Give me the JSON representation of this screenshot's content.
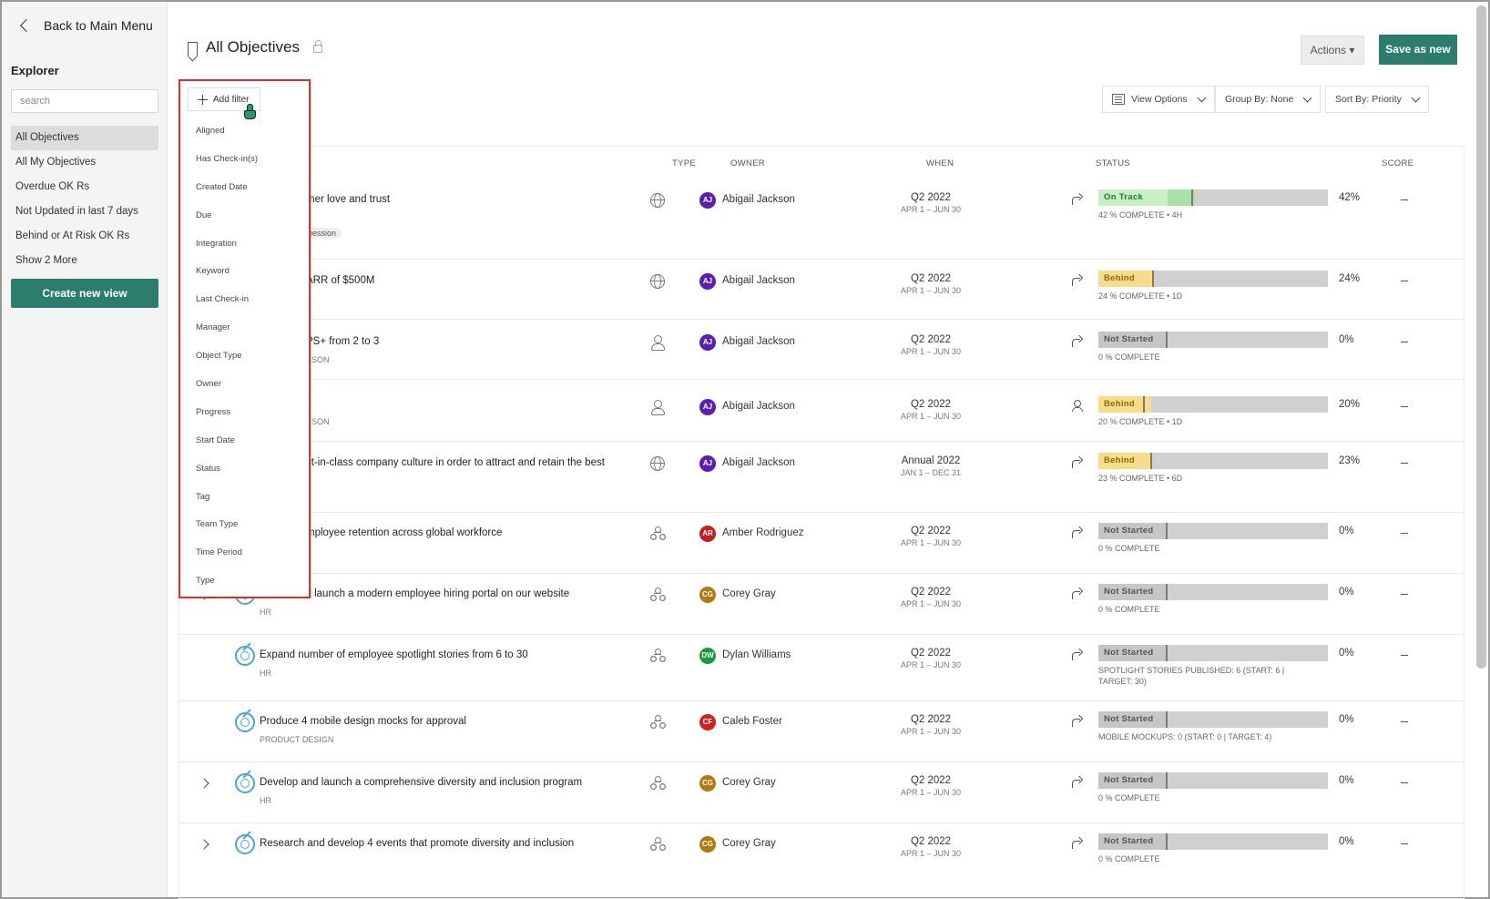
{
  "sidebar": {
    "back_label": "Back to Main Menu",
    "section_title": "Explorer",
    "search_placeholder": "search",
    "nav_items": [
      {
        "label": "All Objectives",
        "active": true
      },
      {
        "label": "All My Objectives",
        "active": false
      },
      {
        "label": "Overdue OK Rs",
        "active": false
      },
      {
        "label": "Not Updated in last 7 days",
        "active": false
      },
      {
        "label": "Behind or At Risk OK Rs",
        "active": false
      },
      {
        "label": "Show 2 More",
        "active": false
      }
    ],
    "create_button": "Create new view"
  },
  "header": {
    "title": "All Objectives",
    "actions_label": "Actions",
    "save_label": "Save as new"
  },
  "toolbar": {
    "view_options": "View Options",
    "group_by": "Group By: None",
    "sort_by": "Sort By: Priority"
  },
  "filter": {
    "add_label": "Add filter",
    "options": [
      "Aligned",
      "Has Check-in(s)",
      "Created Date",
      "Due",
      "Integration",
      "Keyword",
      "Last Check-in",
      "Manager",
      "Object Type",
      "Owner",
      "Progress",
      "Start Date",
      "Status",
      "Tag",
      "Team Type",
      "Time Period",
      "Type"
    ]
  },
  "columns": {
    "type": "TYPE",
    "owner": "OWNER",
    "when": "WHEN",
    "status": "STATUS",
    "score": "SCORE"
  },
  "colors": {
    "accent": "#2d7d6f",
    "on_track": "#a8e2a6",
    "behind": "#f7dc8c",
    "track_bg": "#d0d0d0",
    "highlight": "#e32b2b"
  },
  "rows": [
    {
      "title": "mer love and trust",
      "subtitle": "bession",
      "type_icon": "globe-icon",
      "owner": "Abigail Jackson",
      "initials": "AJ",
      "avatar_color": "#5a1fb0",
      "when": "Q2 2022",
      "when_range": "APR 1 – JUN 30",
      "action_icon": "share-icon",
      "status": "On Track",
      "progress": 42,
      "percent": "42%",
      "status_sub": "42 % COMPLETE • 4H",
      "status_sub2": "",
      "expandable": false
    },
    {
      "title": "ARR of $500M",
      "subtitle": "",
      "type_icon": "globe-icon",
      "owner": "Abigail Jackson",
      "initials": "AJ",
      "avatar_color": "#5a1fb0",
      "when": "Q2 2022",
      "when_range": "APR 1 – JUN 30",
      "action_icon": "share-icon",
      "status": "Behind",
      "progress": 24,
      "percent": "24%",
      "status_sub": "24 % COMPLETE • 1D",
      "status_sub2": "",
      "expandable": false
    },
    {
      "title": "PS+ from 2 to 3",
      "subtitle": "KSON",
      "type_icon": "person-icon",
      "owner": "Abigail Jackson",
      "initials": "AJ",
      "avatar_color": "#5a1fb0",
      "when": "Q2 2022",
      "when_range": "APR 1 – JUN 30",
      "action_icon": "share-icon",
      "status": "Not Started",
      "progress": 0,
      "percent": "0%",
      "status_sub": "0 % COMPLETE",
      "status_sub2": "",
      "expandable": false
    },
    {
      "title": "",
      "subtitle": "KSON",
      "type_icon": "person-icon",
      "owner": "Abigail Jackson",
      "initials": "AJ",
      "avatar_color": "#5a1fb0",
      "when": "Q2 2022",
      "when_range": "APR 1 – JUN 30",
      "action_icon": "user-icon",
      "status": "Behind",
      "progress": 20,
      "percent": "20%",
      "status_sub": "20 % COMPLETE • 1D",
      "status_sub2": "",
      "expandable": false
    },
    {
      "title": "st-in-class company culture in order to attract and retain the best",
      "subtitle": "",
      "type_icon": "globe-icon",
      "owner": "Abigail Jackson",
      "initials": "AJ",
      "avatar_color": "#5a1fb0",
      "when": "Annual 2022",
      "when_range": "JAN 1 – DEC 31",
      "action_icon": "share-icon",
      "status": "Behind",
      "progress": 23,
      "percent": "23%",
      "status_sub": "23 % COMPLETE • 6D",
      "status_sub2": "",
      "expandable": false
    },
    {
      "title": "mployee retention across global workforce",
      "subtitle": "",
      "type_icon": "team-icon",
      "owner": "Amber Rodriguez",
      "initials": "AR",
      "avatar_color": "#c41f1f",
      "when": "Q2 2022",
      "when_range": "APR 1 – JUN 30",
      "action_icon": "share-icon",
      "status": "Not Started",
      "progress": 0,
      "percent": "0%",
      "status_sub": "0 % COMPLETE",
      "status_sub2": "",
      "expandable": false
    },
    {
      "title": "Create and launch a modern employee hiring portal on our website",
      "subtitle": "HR",
      "type_icon": "team-icon",
      "owner": "Corey Gray",
      "initials": "CG",
      "avatar_color": "#b07a10",
      "when": "Q2 2022",
      "when_range": "APR 1 – JUN 30",
      "action_icon": "share-icon",
      "status": "Not Started",
      "progress": 0,
      "percent": "0%",
      "status_sub": "0 % COMPLETE",
      "status_sub2": "",
      "expandable": true
    },
    {
      "title": "Expand number of employee spotlight stories from 6 to 30",
      "subtitle": "HR",
      "type_icon": "team-icon",
      "owner": "Dylan Williams",
      "initials": "DW",
      "avatar_color": "#1d9a3e",
      "when": "Q2 2022",
      "when_range": "APR 1 – JUN 30",
      "action_icon": "share-icon",
      "status": "Not Started",
      "progress": 0,
      "percent": "0%",
      "status_sub": "SPOTLIGHT STORIES PUBLISHED: 6 (START: 6 |",
      "status_sub2": "TARGET: 30)",
      "expandable": false
    },
    {
      "title": "Produce 4 mobile design mocks for approval",
      "subtitle": "PRODUCT DESIGN",
      "type_icon": "team-icon",
      "owner": "Caleb Foster",
      "initials": "CF",
      "avatar_color": "#d42020",
      "when": "Q2 2022",
      "when_range": "APR 1 – JUN 30",
      "action_icon": "share-icon",
      "status": "Not Started",
      "progress": 0,
      "percent": "0%",
      "status_sub": "MOBILE MOCKUPS: 0 (START: 0 | TARGET: 4)",
      "status_sub2": "",
      "expandable": false
    },
    {
      "title": "Develop and launch a comprehensive diversity and inclusion program",
      "subtitle": "HR",
      "type_icon": "team-icon",
      "owner": "Corey Gray",
      "initials": "CG",
      "avatar_color": "#b07a10",
      "when": "Q2 2022",
      "when_range": "APR 1 – JUN 30",
      "action_icon": "share-icon",
      "status": "Not Started",
      "progress": 0,
      "percent": "0%",
      "status_sub": "0 % COMPLETE",
      "status_sub2": "",
      "expandable": true
    },
    {
      "title": "Research and develop 4 events that promote diversity and inclusion",
      "subtitle": "",
      "type_icon": "team-icon",
      "owner": "Corey Gray",
      "initials": "CG",
      "avatar_color": "#b07a10",
      "when": "Q2 2022",
      "when_range": "APR 1 – JUN 30",
      "action_icon": "share-icon",
      "status": "Not Started",
      "progress": 0,
      "percent": "0%",
      "status_sub": "0 % COMPLETE",
      "status_sub2": "",
      "expandable": true
    }
  ],
  "score_placeholder": "—"
}
